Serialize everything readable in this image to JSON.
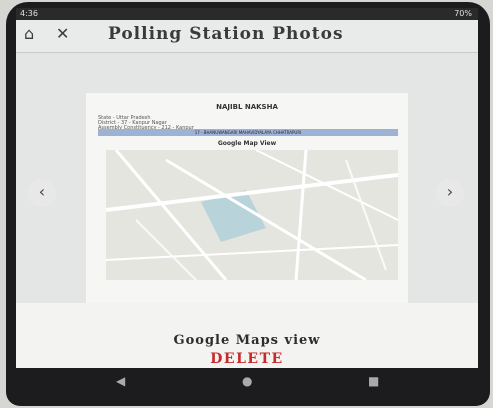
{
  "status": {
    "left": "4:36",
    "right": "70%"
  },
  "appbar": {
    "home_icon": "home-icon",
    "close_icon": "close-icon",
    "title": "Polling Station Photos"
  },
  "document": {
    "heading": "NAJIBL NAKSHA",
    "meta": [
      "State - Uttar Pradesh",
      "District - 37 - Kanpur Nagar",
      "Assembly Constituency - 212 - Kanpur"
    ],
    "bar": "17 - BHANUWANGARI MAHAVIDYALAYA CHHATRAPURI",
    "map_title": "Google Map View"
  },
  "nav": {
    "prev": "‹",
    "next": "›"
  },
  "footer": {
    "view_label": "Google Maps view",
    "delete_label": "DELETE"
  },
  "colors": {
    "delete": "#c62a2a",
    "map_area": "#b9d3db"
  }
}
